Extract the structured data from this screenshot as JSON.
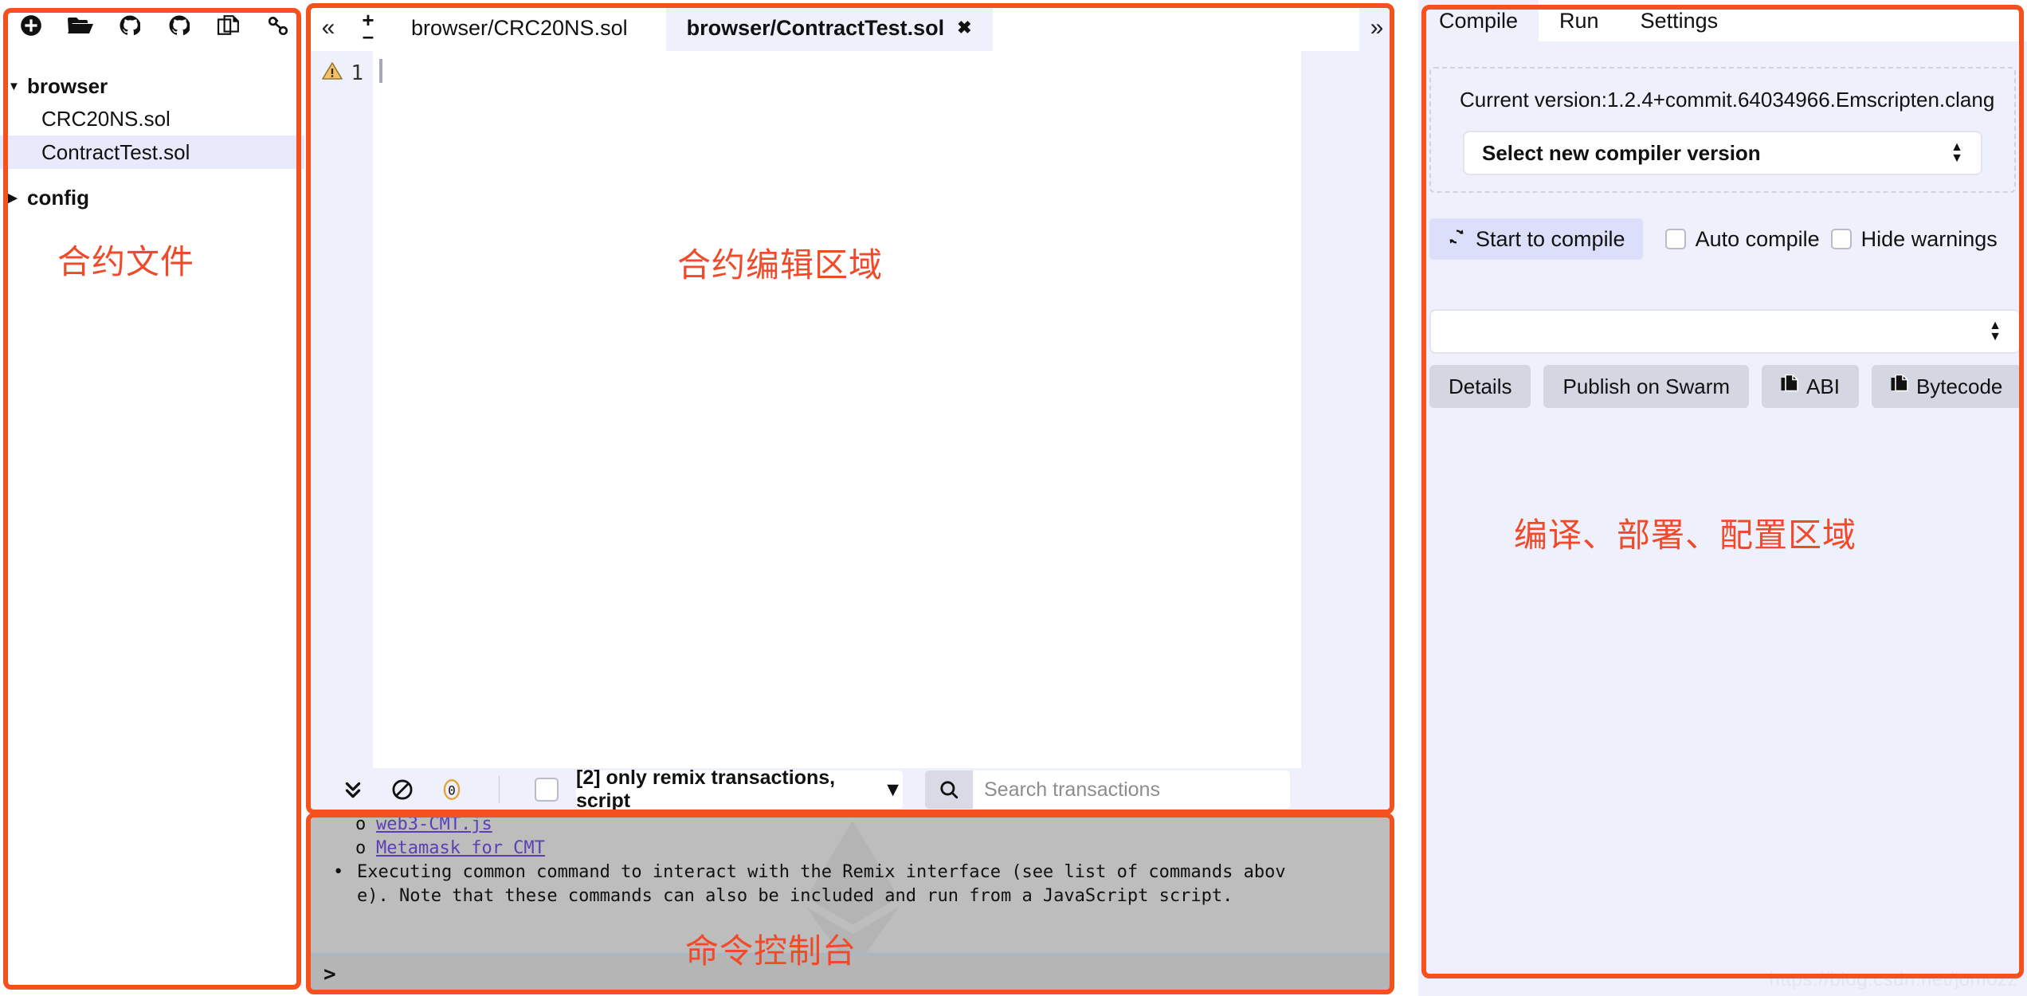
{
  "file_panel": {
    "toolbar_icons": [
      "create-file-icon",
      "open-folder-icon",
      "github-publish-icon",
      "github-gist-icon",
      "copy-files-icon",
      "connect-localhost-icon"
    ],
    "tree": {
      "root_label": "browser",
      "files": [
        {
          "label": "CRC20NS.sol",
          "selected": false
        },
        {
          "label": "ContractTest.sol",
          "selected": true
        }
      ],
      "config_label": "config"
    },
    "annotation": "合约文件"
  },
  "editor": {
    "collapse_icon": "«",
    "more_icon": "»",
    "font_plus": "+",
    "font_minus": "–",
    "tabs": [
      {
        "label": "browser/CRC20NS.sol",
        "active": false
      },
      {
        "label": "browser/ContractTest.sol",
        "active": true,
        "close": "✖"
      }
    ],
    "gutter": [
      {
        "line": "1",
        "warning": true
      }
    ],
    "annotation": "合约编辑区域"
  },
  "tx_toolbar": {
    "icons": [
      "collapse-all-icon",
      "clear-console-icon",
      "pending-count-icon"
    ],
    "pending_count": "0",
    "checkbox_checked": false,
    "filter_label": "[2] only remix transactions, script",
    "search_icon": "search-icon",
    "search_value": "",
    "search_placeholder": "Search transactions"
  },
  "console": {
    "lines": [
      {
        "type": "sub-link",
        "marker": "o",
        "text": "web3-CMT.js"
      },
      {
        "type": "sub-link",
        "marker": "o",
        "text": "Metamask for CMT"
      },
      {
        "type": "blank",
        "text": ""
      },
      {
        "type": "bullet",
        "marker": "•",
        "text": "Executing common command to interact with the Remix interface (see list of commands abov"
      },
      {
        "type": "cont",
        "text": "e). Note that these commands can also be included and run from a JavaScript script."
      }
    ],
    "prompt": ">",
    "annotation": "命令控制台"
  },
  "right_panel": {
    "tabs": [
      {
        "label": "Compile",
        "active": true
      },
      {
        "label": "Run",
        "active": false
      },
      {
        "label": "Settings",
        "active": false
      }
    ],
    "current_version": "Current version:1.2.4+commit.64034966.Emscripten.clang",
    "version_select_label": "Select new compiler version",
    "start_compile_label": "Start to compile",
    "start_compile_icon": "refresh-icon",
    "auto_compile_label": "Auto compile",
    "auto_compile_checked": false,
    "hide_warnings_label": "Hide warnings",
    "hide_warnings_checked": false,
    "contract_select_value": "",
    "buttons": [
      {
        "label": "Details",
        "icon": null
      },
      {
        "label": "Publish on Swarm",
        "icon": null
      },
      {
        "label": "ABI",
        "icon": "copy-icon"
      },
      {
        "label": "Bytecode",
        "icon": "copy-icon"
      }
    ],
    "annotation": "编译、部署、配置区域"
  },
  "watermark": "https://blog.csdn.net/jomozz",
  "colors": {
    "annotation_orange": "#f4511e",
    "panel_bg": "#eef0fc",
    "selected_row": "#e8eafb",
    "console_bg": "#bdbdbd"
  }
}
